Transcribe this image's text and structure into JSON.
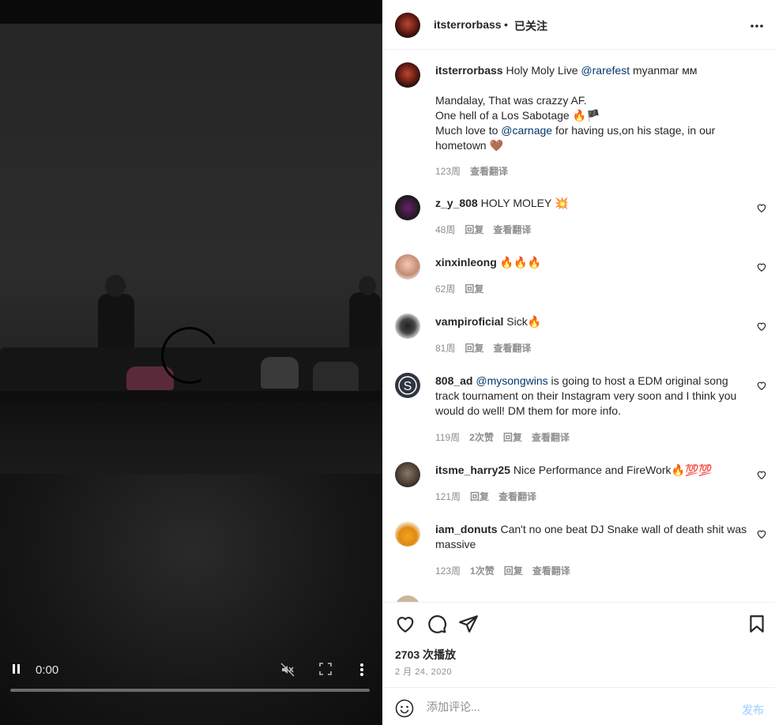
{
  "video": {
    "time": "0:00",
    "icons": {
      "pause": "pause-icon",
      "mute": "muted-speaker-icon",
      "fullscreen": "fullscreen-icon",
      "menu": "vertical-dots-icon"
    },
    "progress": 0
  },
  "header": {
    "username": "itsterrorbass",
    "dot": "•",
    "follow_label": "已关注",
    "more_icon": "more-horizontal-icon"
  },
  "comments": [
    {
      "username": "itsterrorbass",
      "text_parts": [
        " Holy Moly Live ",
        "@rarefest",
        " myanmar ᴍᴍ",
        "",
        "Mandalay, That was crazzy AF.",
        "One hell of a Los Sabotage 🔥🏴",
        "Much love to ",
        "@carnage",
        " for having us,on his stage, in our hometown 🤎"
      ],
      "time": "123周",
      "translate": "查看翻译"
    },
    {
      "username": "z_y_808",
      "text": "HOLY MOLEY 💥",
      "time": "48周",
      "reply": "回复",
      "translate": "查看翻译"
    },
    {
      "username": "xinxinleong",
      "text": "🔥🔥🔥",
      "time": "62周",
      "reply": "回复"
    },
    {
      "username": "vampiroficial",
      "text": "Sick🔥",
      "time": "81周",
      "reply": "回复",
      "translate": "查看翻译"
    },
    {
      "username": "808_ad",
      "mention": "@mysongwins",
      "text": " is going to host a EDM original song track tournament on their Instagram very soon and I think you would do well! DM them for more info.",
      "time": "119周",
      "likes": "2次赞",
      "reply": "回复",
      "translate": "查看翻译"
    },
    {
      "username": "itsme_harry25",
      "text": "Nice Performance and FireWork🔥💯💯",
      "time": "121周",
      "reply": "回复",
      "translate": "查看翻译"
    },
    {
      "username": "iam_donuts",
      "text": "Can't no one beat DJ Snake wall of death shit was massive",
      "time": "123周",
      "likes": "1次赞",
      "reply": "回复",
      "translate": "查看翻译"
    }
  ],
  "actions": {
    "views": "2703 次播放",
    "date": "2 月 24, 2020"
  },
  "composer": {
    "placeholder": "添加评论...",
    "post_label": "发布"
  },
  "colors": {
    "link": "#00376b",
    "muted": "#8e8e8e",
    "post_disabled": "#b3dbff"
  }
}
